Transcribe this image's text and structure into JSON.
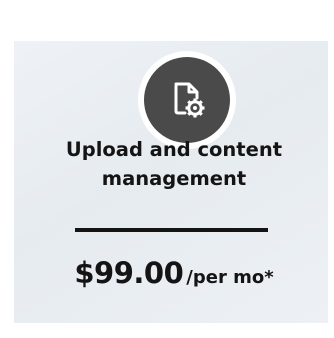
{
  "card": {
    "icon": "file-settings-icon",
    "title": "Upload and content management",
    "price": "$99.00",
    "price_suffix": "/per mo*"
  },
  "colors": {
    "card_background": "#e9edf2",
    "icon_circle": "#4a4a4a",
    "icon_glyph": "#ffffff",
    "text": "#141414"
  }
}
